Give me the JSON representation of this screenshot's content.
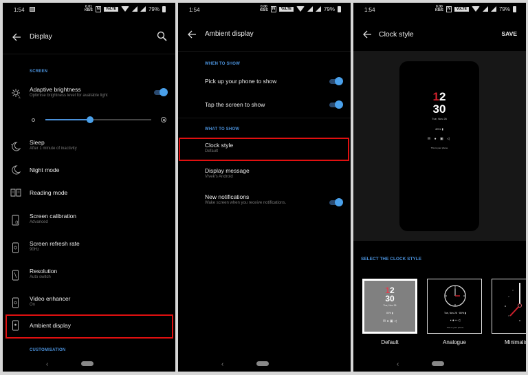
{
  "status_bar": {
    "time": "1:54",
    "net_speed_top": "0.01",
    "net_speed_bottom": "KB/S",
    "net_speed_top_alt": "0.00",
    "nfc": "N",
    "volte": "VoLTE",
    "battery": "79%"
  },
  "panels": {
    "display": {
      "title": "Display",
      "section_screen": "SCREEN",
      "section_customisation": "CUSTOMISATION",
      "brightness_level": 0.42,
      "items": [
        {
          "label": "Adaptive brightness",
          "sub": "Optimise brightness level for available light",
          "toggle": true
        },
        {
          "label": "Sleep",
          "sub": "After 1 minute of inactivity"
        },
        {
          "label": "Night mode",
          "sub": ""
        },
        {
          "label": "Reading mode",
          "sub": ""
        },
        {
          "label": "Screen calibration",
          "sub": "Advanced"
        },
        {
          "label": "Screen refresh rate",
          "sub": "90Hz"
        },
        {
          "label": "Resolution",
          "sub": "Auto switch"
        },
        {
          "label": "Video enhancer",
          "sub": "On"
        },
        {
          "label": "Ambient display",
          "sub": "",
          "highlighted": true
        }
      ]
    },
    "ambient": {
      "title": "Ambient display",
      "section_when": "WHEN TO SHOW",
      "section_what": "WHAT TO SHOW",
      "items": [
        {
          "label": "Pick up your phone to show",
          "sub": "",
          "toggle": true
        },
        {
          "label": "Tap the screen to show",
          "sub": "",
          "toggle": true
        },
        {
          "label": "Clock style",
          "sub": "Default",
          "highlighted": true
        },
        {
          "label": "Display message",
          "sub": "Vivek's Android"
        },
        {
          "label": "New notifications",
          "sub": "Wake screen when you receive notifications.",
          "toggle": true
        }
      ]
    },
    "clock_style": {
      "title": "Clock style",
      "save_label": "SAVE",
      "preview": {
        "hour_first": "1",
        "hour_second": "2",
        "minutes": "30",
        "date": "Tue, Nov 26",
        "battery": "80% ▮",
        "notif_icons": "✉ ● ▣ ◁",
        "message": "This is your phone"
      },
      "select_header": "SELECT THE CLOCK STYLE",
      "options": [
        {
          "label": "Default",
          "selected": true
        },
        {
          "label": "Analogue",
          "selected": false
        },
        {
          "label": "Minimalism",
          "selected": false
        }
      ]
    }
  }
}
